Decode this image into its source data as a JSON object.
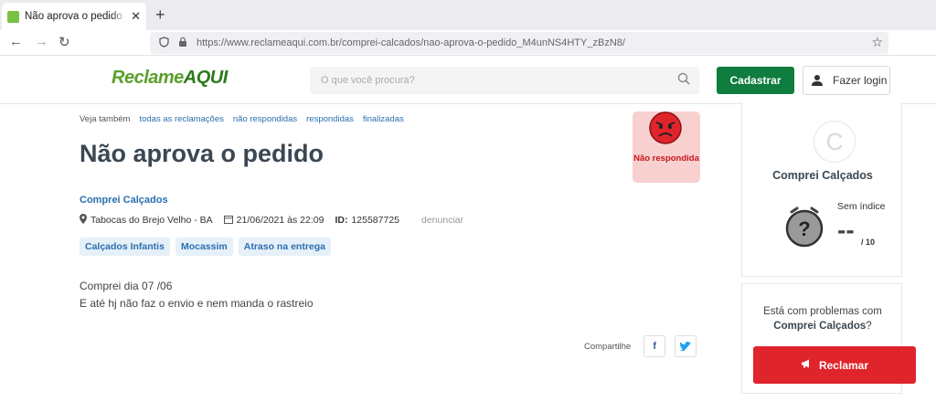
{
  "browser": {
    "tab_title": "Não aprova o pedido - Comprei Calçados",
    "new_tab": "+",
    "tab_close": "✕",
    "url": "https://www.reclameaqui.com.br/comprei-calcados/nao-aprova-o-pedido_M4unNS4HTY_zBzN8/"
  },
  "header": {
    "logo_reclame": "Reclame",
    "logo_aqui": "AQUI",
    "search_placeholder": "O que você procura?",
    "register_label": "Cadastrar",
    "login_label": "Fazer login"
  },
  "see_also": {
    "label": "Veja também",
    "links": [
      "todas as reclamações",
      "não respondidas",
      "respondidas",
      "finalizadas"
    ]
  },
  "complaint": {
    "title": "Não aprova o pedido",
    "status": "Não respondida",
    "company": "Comprei Calçados",
    "location": "Tabocas do Brejo Velho - BA",
    "datetime": "21/06/2021 às 22:09",
    "id_label": "ID:",
    "id_value": "125587725",
    "report_label": "denunciar",
    "tags": [
      "Calçados Infantis",
      "Mocassim",
      "Atraso na entrega"
    ],
    "body_line1": "Comprei dia 07 /06",
    "body_line2": "E até hj não faz o envio e nem manda o rastreio",
    "share_label": "Compartilhe",
    "share_facebook": "f",
    "share_twitter": "t"
  },
  "sidebar": {
    "avatar_letter": "C",
    "company_name": "Comprei Calçados",
    "index_label": "Sem índice",
    "score": "--",
    "score_denominator": "/ 10",
    "problem_text": "Está com problemas com",
    "problem_company": "Comprei Calçados",
    "problem_suffix": "?",
    "complain_label": "Reclamar"
  },
  "colors": {
    "brand_green": "#0e7d3e",
    "link_blue": "#2a6fb0",
    "status_red": "#c4161c",
    "complain_red": "#e0242b"
  }
}
